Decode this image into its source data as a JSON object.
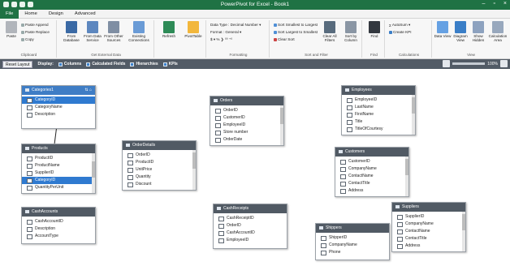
{
  "app": {
    "title": "PowerPivot for Excel - Book1",
    "window_controls": [
      "–",
      "▫",
      "×"
    ]
  },
  "menu": [
    "File",
    "Home",
    "Design",
    "Advanced"
  ],
  "ribbon": {
    "clipboard": {
      "paste": "Paste",
      "paste_append": "Paste Append",
      "paste_replace": "Paste Replace",
      "copy": "Copy",
      "label": "Clipboard"
    },
    "external": {
      "from_db": "From Database",
      "from_service": "From Data Service",
      "from_other": "From Other Sources",
      "existing": "Existing Connections",
      "label": "Get External Data"
    },
    "refresh": "Refresh",
    "pivottable": "PivotTable",
    "formatting": {
      "data_type": "Data Type : Decimal Number ▾",
      "format": "Format : General ▾",
      "symbols": "$ ▾ % ❯ ⁰⁰ ⁺⁰",
      "label": "Formatting"
    },
    "sortfilter": {
      "asc": "Sort Smallest to Largest",
      "desc": "Sort Largest to Smallest",
      "clear_sort": "Clear Sort",
      "clear_filters": "Clear All Filters",
      "sort_by": "Sort by Column",
      "label": "Sort and Filter"
    },
    "find": {
      "btn": "Find",
      "label": "Find"
    },
    "calculations": {
      "autosum": "AutoSum ▾",
      "create_kpi": "Create KPI",
      "label": "Calculations"
    },
    "view": {
      "data": "Data View",
      "diagram": "Diagram View",
      "hidden": "Show Hidden",
      "calc_area": "Calculation Area",
      "label": "View"
    }
  },
  "toolbar": {
    "reset": "Reset Layout",
    "display": "Display:",
    "options": [
      "Columns",
      "Calculated Fields",
      "Hierarchies",
      "KPIs"
    ],
    "zoom": "100%"
  },
  "tables": [
    {
      "name": "Categories1",
      "selected": true,
      "icons": "⇅ ⌂",
      "rows": [
        "CategoryID",
        "CategoryName",
        "Description"
      ],
      "highlight": 0,
      "scroll": false
    },
    {
      "name": "Orders",
      "selected": false,
      "rows": [
        "OrderID",
        "CustomerID",
        "EmployeeID",
        "Store number",
        "OrderDate"
      ],
      "scroll": true
    },
    {
      "name": "Employees",
      "selected": false,
      "rows": [
        "EmployeeID",
        "LastName",
        "FirstName",
        "Title",
        "TitleOfCourtesy"
      ],
      "scroll": true
    },
    {
      "name": "Products",
      "selected": false,
      "rows": [
        "ProductID",
        "ProductName",
        "SupplierID",
        "CategoryID",
        "QuantityPerUnit"
      ],
      "highlight": 3,
      "scroll": true
    },
    {
      "name": "OrderDetails",
      "selected": false,
      "rows": [
        "OrderID",
        "ProductID",
        "UnitPrice",
        "Quantity",
        "Discount"
      ],
      "scroll": true
    },
    {
      "name": "Customers",
      "selected": false,
      "rows": [
        "CustomerID",
        "CompanyName",
        "ContactName",
        "ContactTitle",
        "Address"
      ],
      "scroll": true
    },
    {
      "name": "CashAccounts",
      "selected": false,
      "rows": [
        "CashAccountID",
        "Description",
        "AccountType"
      ],
      "scroll": false
    },
    {
      "name": "CashReceipts",
      "selected": false,
      "rows": [
        "CashReceiptID",
        "OrderID",
        "CashAccountID",
        "EmployeeID"
      ],
      "scroll": false
    },
    {
      "name": "Shippers",
      "selected": false,
      "rows": [
        "ShipperID",
        "CompanyName",
        "Phone"
      ],
      "scroll": false
    },
    {
      "name": "Suppliers",
      "selected": false,
      "rows": [
        "SupplierID",
        "CompanyName",
        "ContactName",
        "ContactTitle",
        "Address"
      ],
      "scroll": true
    }
  ]
}
